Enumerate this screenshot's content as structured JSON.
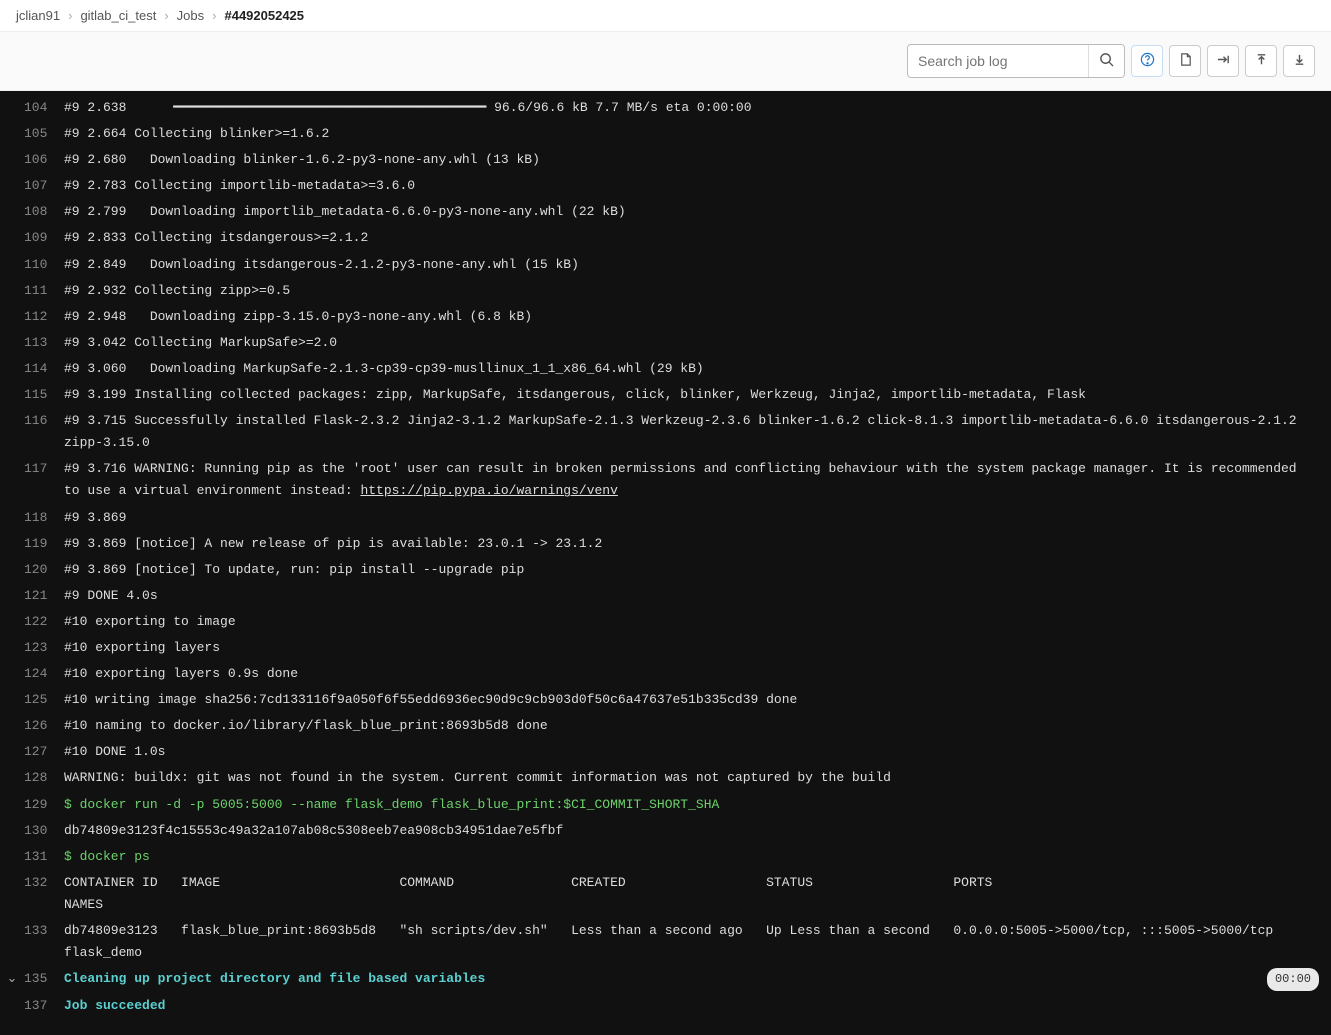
{
  "breadcrumb": {
    "items": [
      "jclian91",
      "gitlab_ci_test",
      "Jobs"
    ],
    "current": "#4492052425"
  },
  "toolbar": {
    "search_placeholder": "Search job log"
  },
  "log": {
    "lines": [
      {
        "n": "104",
        "t": "#9 2.638      ━━━━━━━━━━━━━━━━━━━━━━━━━━━━━━━━━━━━━━━━ 96.6/96.6 kB 7.7 MB/s eta 0:00:00"
      },
      {
        "n": "105",
        "t": "#9 2.664 Collecting blinker>=1.6.2"
      },
      {
        "n": "106",
        "t": "#9 2.680   Downloading blinker-1.6.2-py3-none-any.whl (13 kB)"
      },
      {
        "n": "107",
        "t": "#9 2.783 Collecting importlib-metadata>=3.6.0"
      },
      {
        "n": "108",
        "t": "#9 2.799   Downloading importlib_metadata-6.6.0-py3-none-any.whl (22 kB)"
      },
      {
        "n": "109",
        "t": "#9 2.833 Collecting itsdangerous>=2.1.2"
      },
      {
        "n": "110",
        "t": "#9 2.849   Downloading itsdangerous-2.1.2-py3-none-any.whl (15 kB)"
      },
      {
        "n": "111",
        "t": "#9 2.932 Collecting zipp>=0.5"
      },
      {
        "n": "112",
        "t": "#9 2.948   Downloading zipp-3.15.0-py3-none-any.whl (6.8 kB)"
      },
      {
        "n": "113",
        "t": "#9 3.042 Collecting MarkupSafe>=2.0"
      },
      {
        "n": "114",
        "t": "#9 3.060   Downloading MarkupSafe-2.1.3-cp39-cp39-musllinux_1_1_x86_64.whl (29 kB)"
      },
      {
        "n": "115",
        "t": "#9 3.199 Installing collected packages: zipp, MarkupSafe, itsdangerous, click, blinker, Werkzeug, Jinja2, importlib-metadata, Flask"
      },
      {
        "n": "116",
        "t": "#9 3.715 Successfully installed Flask-2.3.2 Jinja2-3.1.2 MarkupSafe-2.1.3 Werkzeug-2.3.6 blinker-1.6.2 click-8.1.3 importlib-metadata-6.6.0 itsdangerous-2.1.2 zipp-3.15.0"
      },
      {
        "n": "117",
        "t": "#9 3.716 WARNING: Running pip as the 'root' user can result in broken permissions and conflicting behaviour with the system package manager. It is recommended to use a virtual environment instead: ",
        "link": "https://pip.pypa.io/warnings/venv"
      },
      {
        "n": "118",
        "t": "#9 3.869"
      },
      {
        "n": "119",
        "t": "#9 3.869 [notice] A new release of pip is available: 23.0.1 -> 23.1.2"
      },
      {
        "n": "120",
        "t": "#9 3.869 [notice] To update, run: pip install --upgrade pip"
      },
      {
        "n": "121",
        "t": "#9 DONE 4.0s"
      },
      {
        "n": "122",
        "t": "#10 exporting to image"
      },
      {
        "n": "123",
        "t": "#10 exporting layers"
      },
      {
        "n": "124",
        "t": "#10 exporting layers 0.9s done"
      },
      {
        "n": "125",
        "t": "#10 writing image sha256:7cd133116f9a050f6f55edd6936ec90d9c9cb903d0f50c6a47637e51b335cd39 done"
      },
      {
        "n": "126",
        "t": "#10 naming to docker.io/library/flask_blue_print:8693b5d8 done"
      },
      {
        "n": "127",
        "t": "#10 DONE 1.0s"
      },
      {
        "n": "128",
        "t": "WARNING: buildx: git was not found in the system. Current commit information was not captured by the build"
      },
      {
        "n": "129",
        "t": "$ docker run -d -p 5005:5000 --name flask_demo flask_blue_print:$CI_COMMIT_SHORT_SHA",
        "cls": "cmd"
      },
      {
        "n": "130",
        "t": "db74809e3123f4c15553c49a32a107ab08c5308eeb7ea908cb34951dae7e5fbf"
      },
      {
        "n": "131",
        "t": "$ docker ps",
        "cls": "cmd"
      },
      {
        "n": "132",
        "t": "CONTAINER ID   IMAGE                       COMMAND               CREATED                  STATUS                  PORTS                                       NAMES"
      },
      {
        "n": "133",
        "t": "db74809e3123   flask_blue_print:8693b5d8   \"sh scripts/dev.sh\"   Less than a second ago   Up Less than a second   0.0.0.0:5005->5000/tcp, :::5005->5000/tcp   flask_demo"
      },
      {
        "n": "135",
        "t": "Cleaning up project directory and file based variables",
        "cls": "section",
        "caret": true,
        "badge": "00:00"
      },
      {
        "n": "137",
        "t": "Job succeeded",
        "cls": "success"
      }
    ]
  }
}
